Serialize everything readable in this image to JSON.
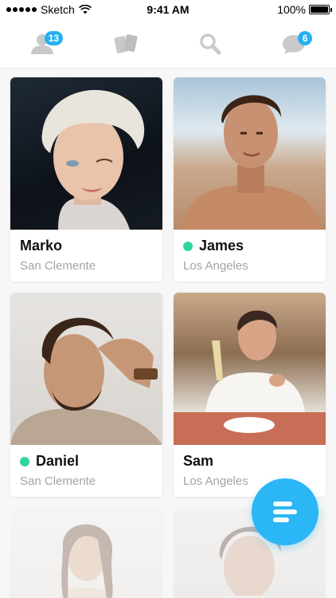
{
  "status_bar": {
    "carrier": "Sketch",
    "time": "9:41 AM",
    "battery": "100%",
    "battery_level": 1.0
  },
  "nav": {
    "icons": [
      "people-icon",
      "cards-icon",
      "search-icon",
      "chat-bubble-icon"
    ],
    "people_badge": "13",
    "chat_badge": "6",
    "accent_color": "#25b1f0"
  },
  "profiles": [
    {
      "name": "Marko",
      "city": "San Clemente",
      "online": false
    },
    {
      "name": "James",
      "city": "Los Angeles",
      "online": true
    },
    {
      "name": "Daniel",
      "city": "San Clemente",
      "online": true
    },
    {
      "name": "Sam",
      "city": "Los Angeles",
      "online": false
    }
  ],
  "colors": {
    "online": "#2fd69a",
    "fab": "#2bb6f5",
    "secondary_text": "#a3a3a3"
  },
  "fab": {
    "icon": "menu-bars-icon"
  }
}
